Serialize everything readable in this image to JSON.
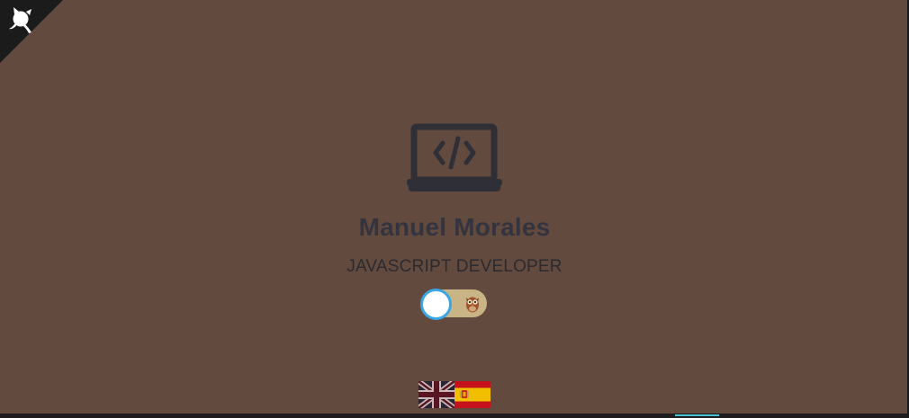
{
  "profile": {
    "name": "Manuel Morales",
    "role": "JAVASCRIPT DEVELOPER"
  },
  "icons": {
    "corner": "github-octocat-icon",
    "hero": "laptop-code-icon",
    "theme_toggle": "owl-icon"
  },
  "theme_toggle": {
    "state": "off"
  },
  "languages": [
    {
      "code": "en",
      "flag": "uk-flag-icon"
    },
    {
      "code": "es",
      "flag": "spain-flag-icon"
    }
  ],
  "colors": {
    "background": "#624a3e",
    "text_dark": "#343440",
    "toggle_track": "#c9b486",
    "toggle_knob_border": "#3aa6e6",
    "corner_ribbon": "#1b1b1b"
  }
}
